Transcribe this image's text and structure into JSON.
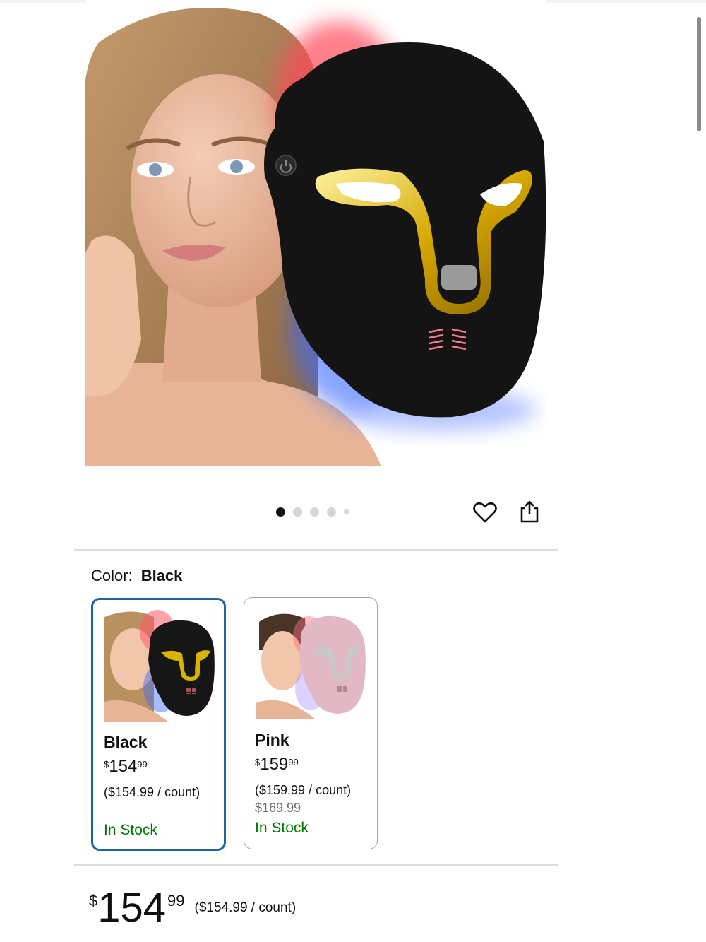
{
  "gallery": {
    "image_count": 5,
    "active_index": 0,
    "hero_image_alt": "LED face mask product image with model",
    "actions": {
      "favorite_icon": "heart-icon",
      "share_icon": "share-icon"
    }
  },
  "color": {
    "label": "Color:",
    "selected": "Black"
  },
  "variants": [
    {
      "name": "Black",
      "price_currency": "$",
      "price_whole": "154",
      "price_fraction": "99",
      "unit_price": "($154.99 / count)",
      "list_price": "",
      "stock": "In Stock",
      "mask_color": "#151515",
      "accent_color": "#d8b300",
      "selected": true
    },
    {
      "name": "Pink",
      "price_currency": "$",
      "price_whole": "159",
      "price_fraction": "99",
      "unit_price": "($159.99 / count)",
      "list_price": "$169.99",
      "stock": "In Stock",
      "mask_color": "#e2b8c4",
      "accent_color": "#c8c8c8",
      "selected": false
    }
  ],
  "price": {
    "currency": "$",
    "whole": "154",
    "fraction": "99",
    "unit": "($154.99 / count)"
  },
  "colors": {
    "selected_border": "#2162a1",
    "in_stock": "#007600",
    "divider": "#dddddd"
  }
}
